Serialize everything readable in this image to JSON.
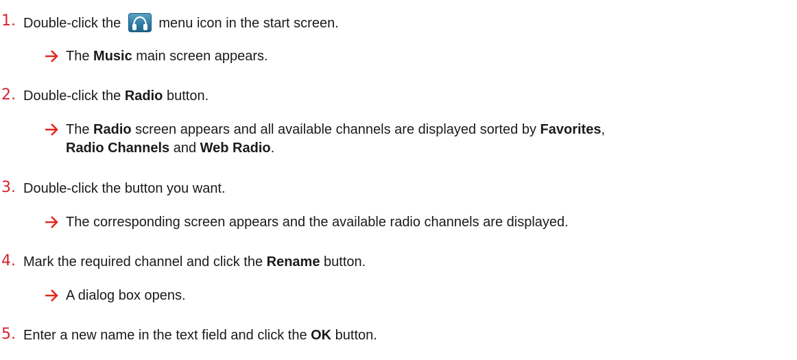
{
  "colors": {
    "step_number": "#d4232e",
    "arrow": "#e0281f",
    "text": "#1a1a1a",
    "icon_gradient_top": "#5fa6c6",
    "icon_gradient_bottom": "#1f6288"
  },
  "icons": {
    "arrow": "right-arrow",
    "music_menu": "headphones-icon"
  },
  "steps": [
    {
      "number": "1.",
      "text_before_icon": "Double-click the ",
      "text_after_icon": " menu icon in the start screen.",
      "result": {
        "before": "The ",
        "bold1": "Music",
        "after": " main screen appears."
      }
    },
    {
      "number": "2.",
      "text_before": "Double-click the ",
      "bold": "Radio",
      "text_after": " button.",
      "result": {
        "p1": "The ",
        "b1": "Radio",
        "p2": " screen appears and all available channels are displayed sorted by ",
        "b2": "Favorites",
        "p3": ",",
        "b3": "Radio Channels",
        "p4": " and ",
        "b4": "Web Radio",
        "p5": "."
      }
    },
    {
      "number": "3.",
      "text": "Double-click the button you want.",
      "result": {
        "text": "The corresponding screen appears and the available radio channels are displayed."
      }
    },
    {
      "number": "4.",
      "text_before": "Mark the required channel and click the ",
      "bold": "Rename",
      "text_after": " button.",
      "result": {
        "text": "A dialog box opens."
      }
    },
    {
      "number": "5.",
      "text_before": "Enter a new name in the text field and click the ",
      "bold": "OK",
      "text_after": " button."
    }
  ]
}
